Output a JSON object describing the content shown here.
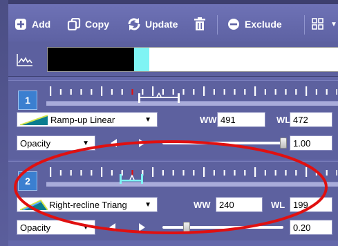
{
  "toolbar": {
    "add_label": "Add",
    "copy_label": "Copy",
    "update_label": "Update",
    "exclude_label": "Exclude",
    "icons": [
      "plus-circle-icon",
      "copy-icon",
      "refresh-icon",
      "trash-icon",
      "minus-circle-icon",
      "grid-icon"
    ]
  },
  "preview": {
    "colors": {
      "black": "#000000",
      "cyan": "#7ff4f4",
      "white": "#ffffff"
    }
  },
  "panels": [
    {
      "number": "1",
      "function": "Ramp-up Linear",
      "ww_label": "WW",
      "ww_value": "491",
      "wl_label": "WL",
      "wl_value": "472",
      "mode": "Opacity",
      "opacity_value": "1.00",
      "opacity_level": 1.0,
      "range_color": "#ffffff"
    },
    {
      "number": "2",
      "function": "Right-recline Triang",
      "ww_label": "WW",
      "ww_value": "240",
      "wl_label": "WL",
      "wl_value": "199",
      "mode": "Opacity",
      "opacity_value": "0.20",
      "opacity_level": 0.2,
      "range_color": "#7ff4f4"
    }
  ],
  "annotation": {
    "color": "#e01010"
  }
}
